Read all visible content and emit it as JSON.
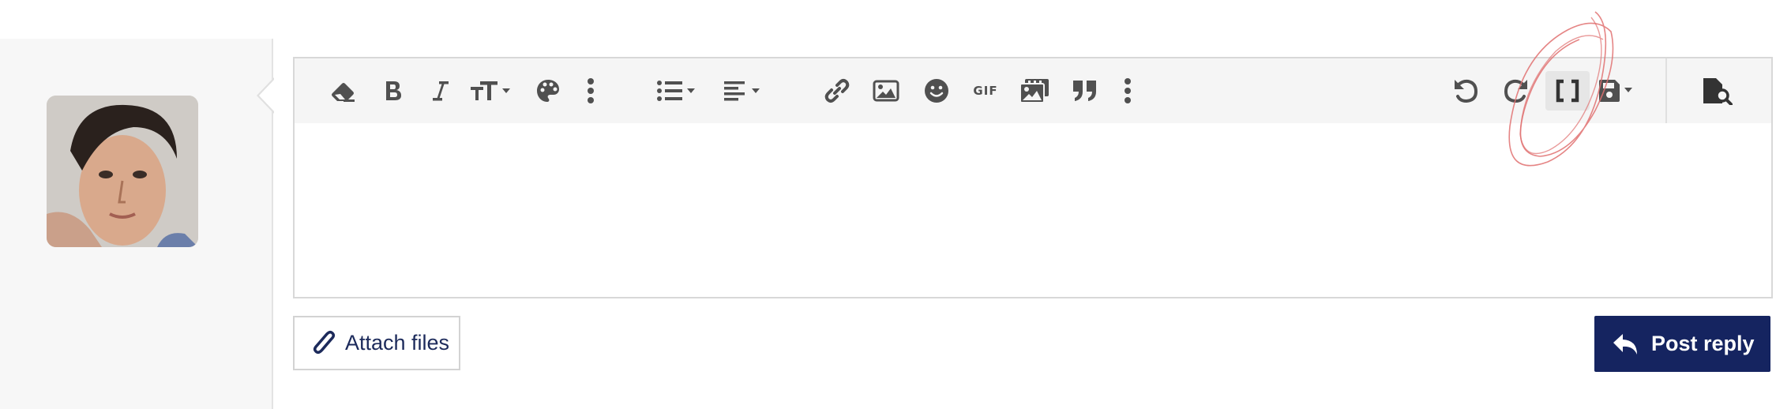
{
  "sidebar": {
    "avatar_alt": "User avatar"
  },
  "toolbar": {
    "left": [
      {
        "name": "clear-formatting",
        "icon": "eraser-icon"
      },
      {
        "name": "bold",
        "icon": "bold-icon"
      },
      {
        "name": "italic",
        "icon": "italic-icon"
      },
      {
        "name": "font-size",
        "icon": "text-size-icon"
      },
      {
        "name": "text-color",
        "icon": "palette-icon"
      },
      {
        "name": "more-text",
        "icon": "more-vertical-icon"
      },
      {
        "name": "list",
        "icon": "list-icon"
      },
      {
        "name": "align",
        "icon": "align-left-icon"
      },
      {
        "name": "insert-link",
        "icon": "link-icon"
      },
      {
        "name": "insert-image",
        "icon": "image-icon"
      },
      {
        "name": "insert-emoji",
        "icon": "smiley-icon"
      },
      {
        "name": "insert-gif",
        "icon": "gif-icon",
        "label": "GIF"
      },
      {
        "name": "insert-media",
        "icon": "media-icon"
      },
      {
        "name": "quote",
        "icon": "quote-icon"
      },
      {
        "name": "more-insert",
        "icon": "more-vertical-icon"
      }
    ],
    "right": [
      {
        "name": "undo",
        "icon": "undo-icon"
      },
      {
        "name": "redo",
        "icon": "redo-icon"
      },
      {
        "name": "toggle-bbcode",
        "icon": "brackets-icon",
        "active": true
      },
      {
        "name": "drafts",
        "icon": "save-icon"
      },
      {
        "name": "preview",
        "icon": "preview-icon"
      }
    ]
  },
  "editor": {
    "content": ""
  },
  "actions": {
    "attach_label": "Attach files",
    "post_label": "Post reply"
  },
  "colors": {
    "primary": "#152460",
    "icon": "#505050",
    "attach_text": "#1c2a5b",
    "annotation": "#e07070"
  }
}
